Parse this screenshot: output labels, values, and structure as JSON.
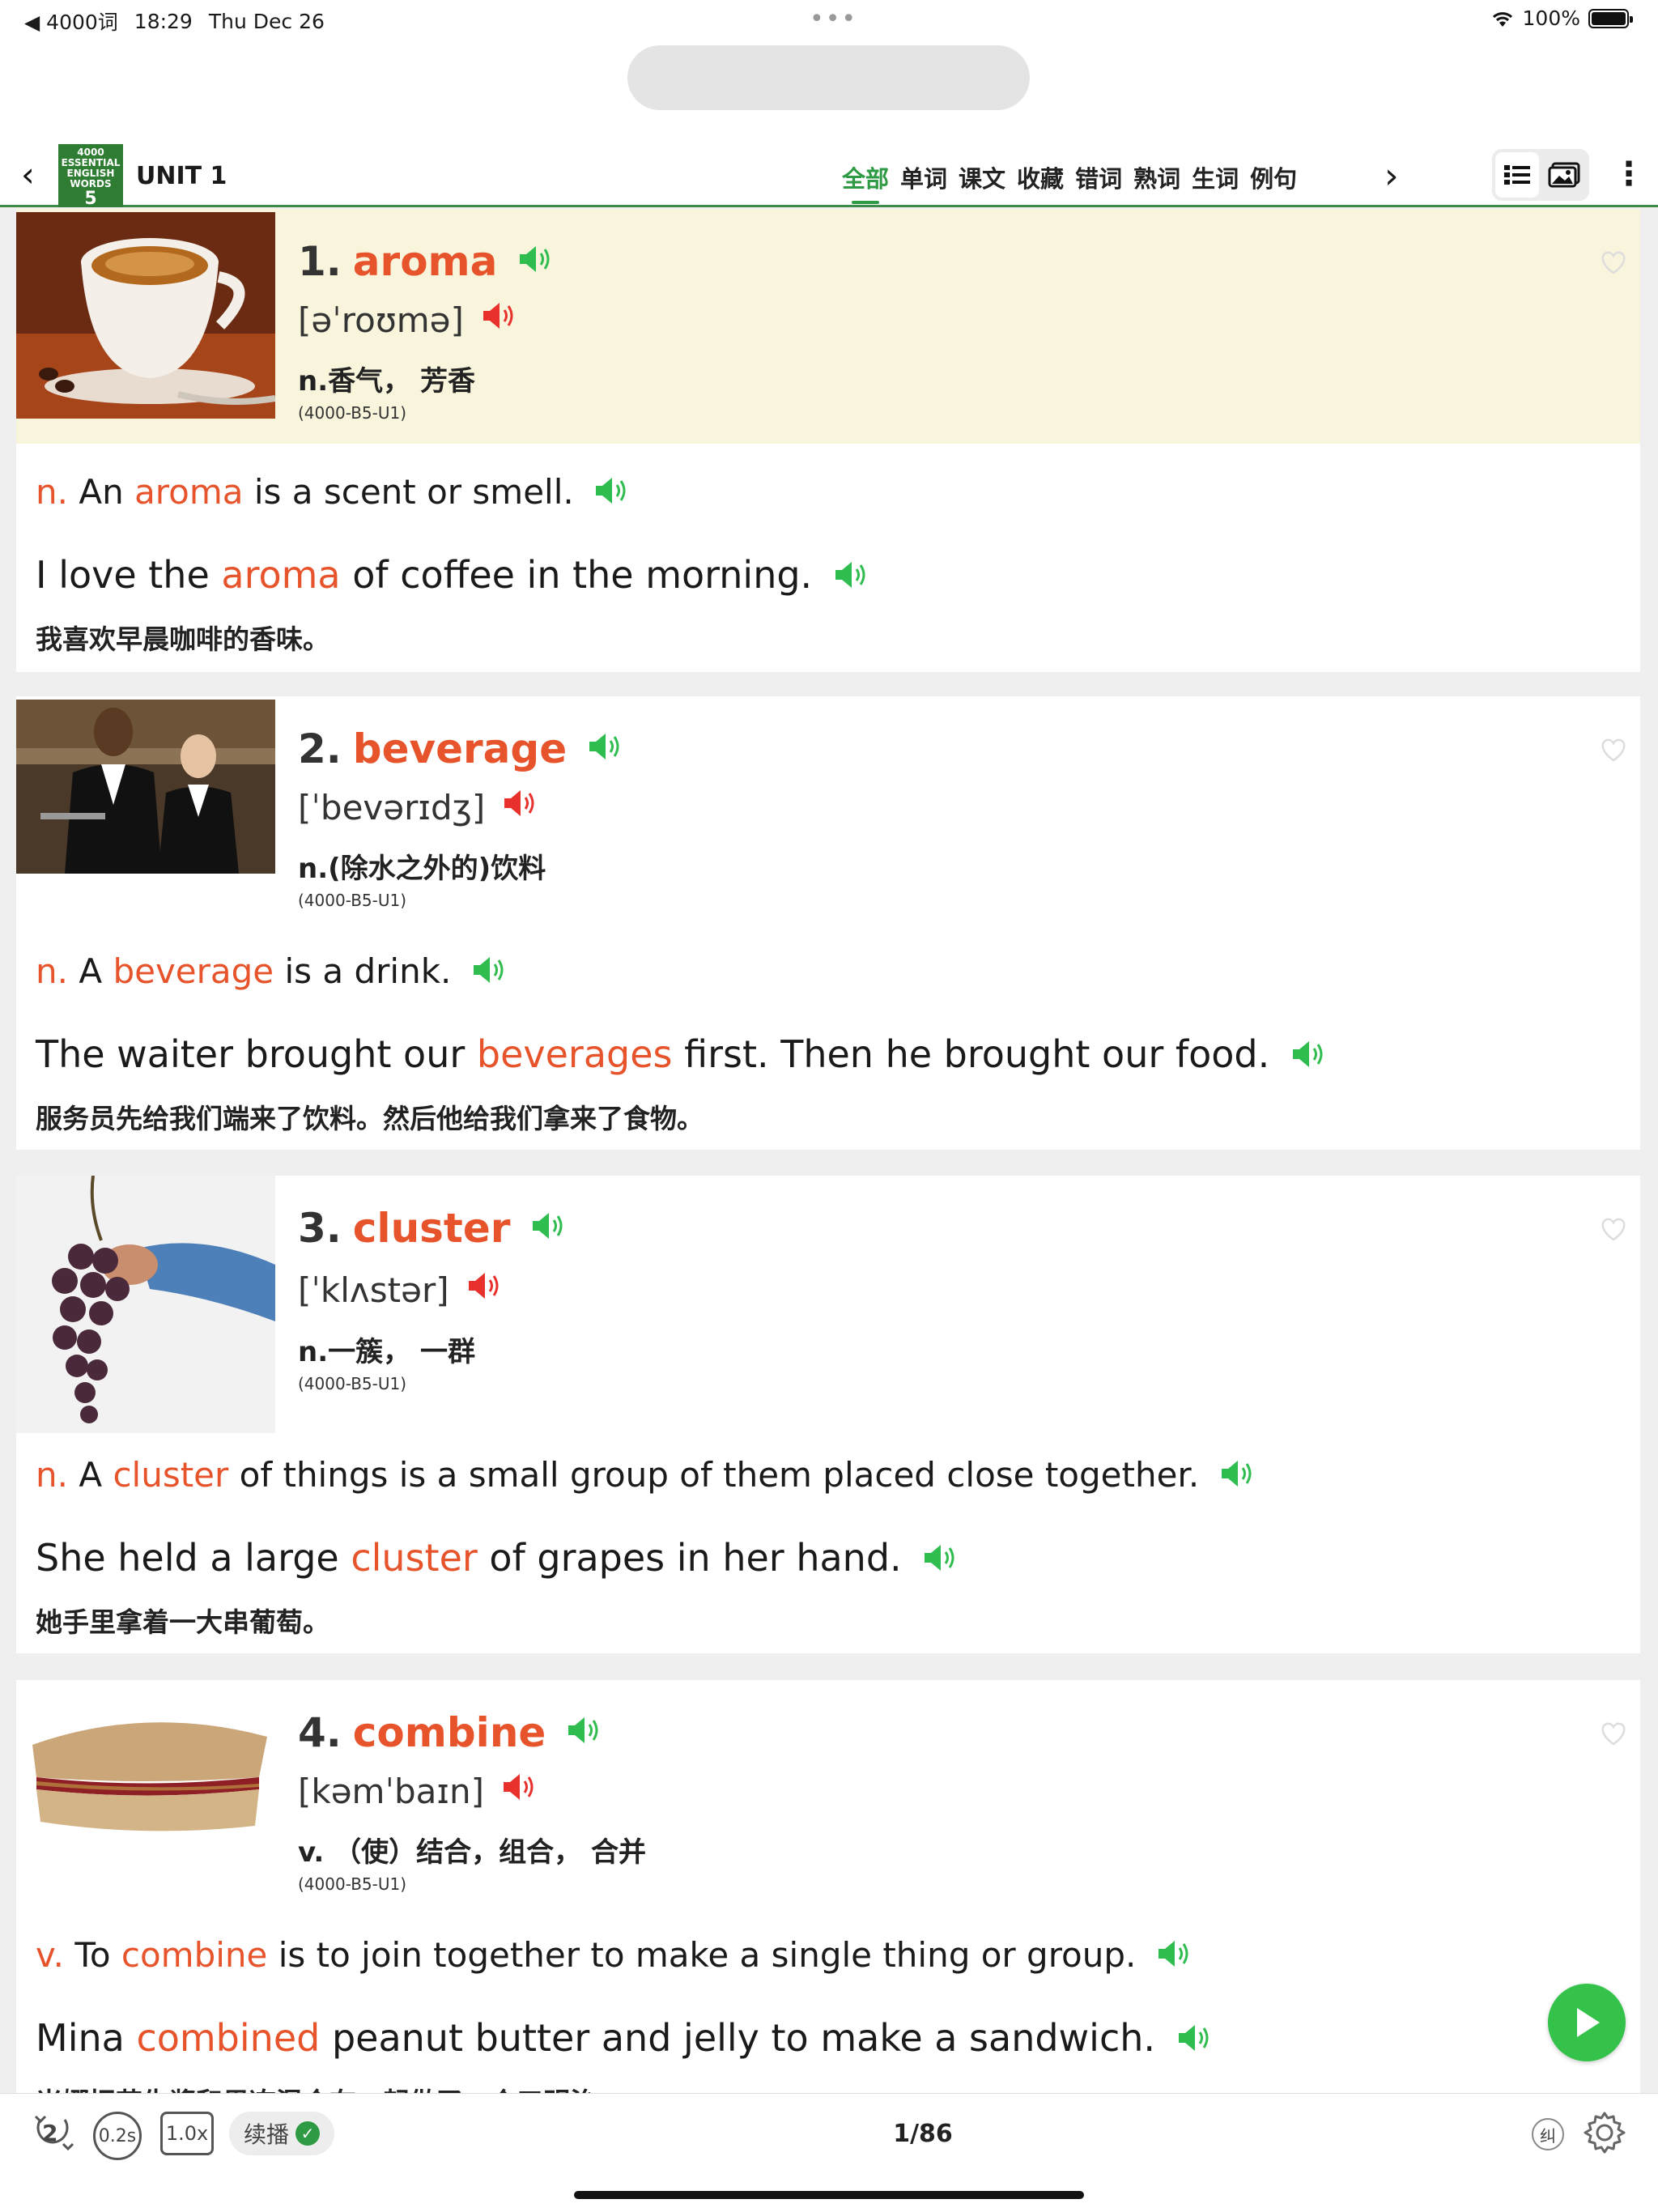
{
  "status": {
    "back_app": "◀ 4000词",
    "time": "18:29",
    "date": "Thu Dec 26",
    "battery": "100%"
  },
  "header": {
    "logo_text": "4000 ESSENTIAL ENGLISH WORDS",
    "logo_num": "5",
    "unit": "UNIT 1",
    "tabs": [
      "全部",
      "单词",
      "课文",
      "收藏",
      "错词",
      "熟词",
      "生词",
      "例句"
    ],
    "active_tab": "全部"
  },
  "words": [
    {
      "num": "1.",
      "word": "aroma",
      "phonetic": "[əˈroʊmə]",
      "meaning": "n.香气，  芳香",
      "code": "(4000-B5-U1)",
      "def_pos": "n.",
      "def_pre": "An",
      "def_word": "aroma",
      "def_post": "is a scent or smell.",
      "ex_pre": "I love the",
      "ex_word": "aroma",
      "ex_post": "of coffee in the morning.",
      "zh": "我喜欢早晨咖啡的香味。"
    },
    {
      "num": "2.",
      "word": "beverage",
      "phonetic": "[ˈbevərɪdʒ]",
      "meaning": "n.(除水之外的)饮料",
      "code": "(4000-B5-U1)",
      "def_pos": "n.",
      "def_pre": "A",
      "def_word": "beverage",
      "def_post": "is a drink.",
      "ex_pre": "The waiter brought our",
      "ex_word": "beverages",
      "ex_post": "first. Then he brought our food.",
      "zh": "服务员先给我们端来了饮料。然后他给我们拿来了食物。"
    },
    {
      "num": "3.",
      "word": "cluster",
      "phonetic": "[ˈklʌstər]",
      "meaning": "n.一簇，  一群",
      "code": "(4000-B5-U1)",
      "def_pos": "n.",
      "def_pre": "A",
      "def_word": "cluster",
      "def_post": "of things is a small group of them placed close together.",
      "ex_pre": "She held a large",
      "ex_word": "cluster",
      "ex_post": "of grapes in her hand.",
      "zh": "她手里拿着一大串葡萄。"
    },
    {
      "num": "4.",
      "word": "combine",
      "phonetic": "[kəmˈbaɪn]",
      "meaning": "v. （使）结合，组合，  合并",
      "code": "(4000-B5-U1)",
      "def_pos": "v.",
      "def_pre": "To",
      "def_word": "combine",
      "def_post": "is to join together to make a single thing or group.",
      "ex_pre": "Mina",
      "ex_word": "combined",
      "ex_post": "peanut butter and jelly to make a sandwich.",
      "zh": "米娜把花生酱和果冻混合在一起做了一个三明治。"
    }
  ],
  "bottom": {
    "repeat": "2",
    "interval": "0.2s",
    "speed": "1.0x",
    "continue_label": "续播",
    "page": "1/86",
    "correction_label": "纠"
  },
  "colors": {
    "accent_green": "#2e9a43",
    "word_orange": "#e7532a",
    "highlight_bg": "#f8f5dc"
  }
}
